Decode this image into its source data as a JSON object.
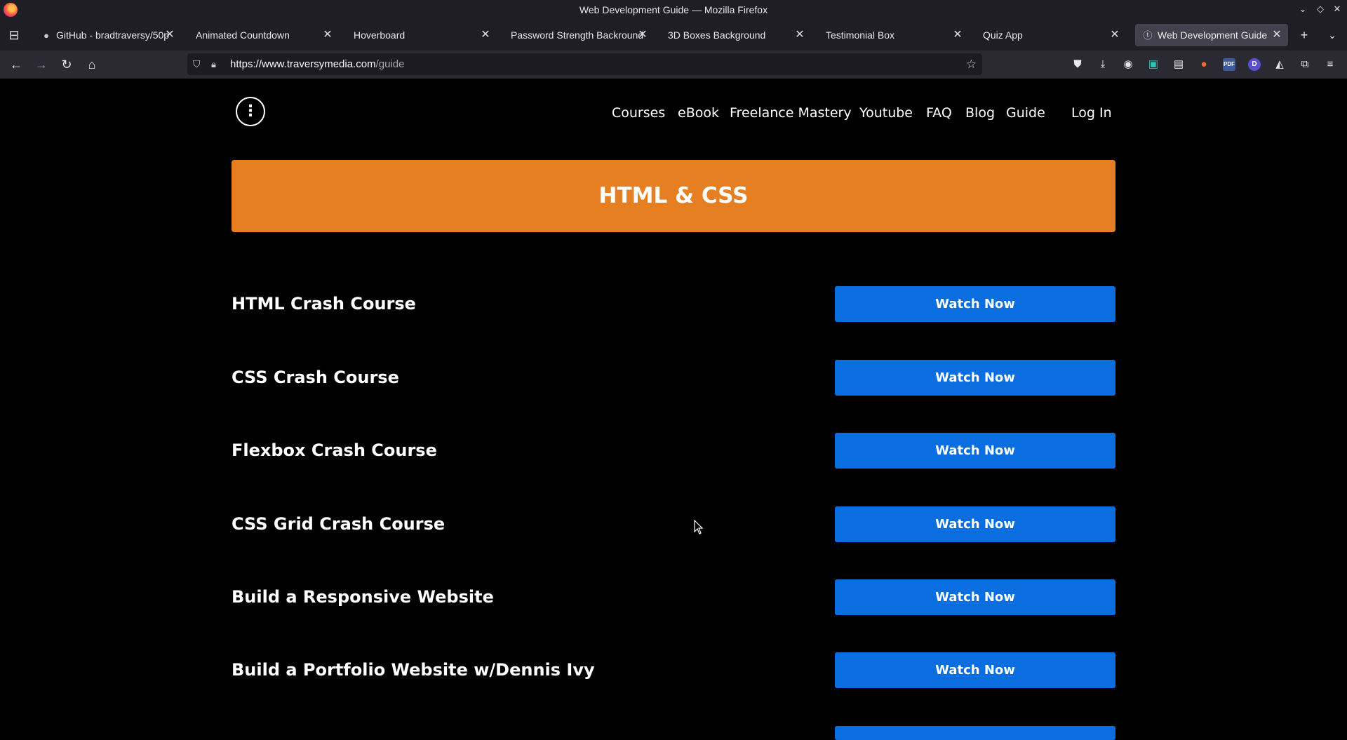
{
  "window": {
    "title": "Web Development Guide — Mozilla Firefox"
  },
  "tabs": [
    {
      "label": "GitHub - bradtraversy/50p",
      "icon": "github-icon",
      "active": false
    },
    {
      "label": "Animated Countdown",
      "icon": "",
      "active": false
    },
    {
      "label": "Hoverboard",
      "icon": "",
      "active": false
    },
    {
      "label": "Password Strength Backround",
      "icon": "",
      "active": false
    },
    {
      "label": "3D Boxes Background",
      "icon": "",
      "active": false
    },
    {
      "label": "Testimonial Box",
      "icon": "",
      "active": false
    },
    {
      "label": "Quiz App",
      "icon": "",
      "active": false
    },
    {
      "label": "Web Development Guide",
      "icon": "traversy-favicon-icon",
      "active": true
    }
  ],
  "urlbar": {
    "host": "https://www.traversymedia.com",
    "path": "/guide"
  },
  "site": {
    "logo_text": "⋮",
    "nav": [
      "Courses",
      "eBook",
      "Freelance Mastery",
      "Youtube",
      "FAQ",
      "Blog",
      "Guide"
    ],
    "login": "Log In"
  },
  "section": {
    "title": "HTML & CSS"
  },
  "courses": [
    {
      "title": "HTML Crash Course",
      "button": "Watch Now"
    },
    {
      "title": "CSS Crash Course",
      "button": "Watch Now"
    },
    {
      "title": "Flexbox Crash Course",
      "button": "Watch Now"
    },
    {
      "title": "CSS Grid Crash Course",
      "button": "Watch Now"
    },
    {
      "title": "Build a Responsive Website",
      "button": "Watch Now"
    },
    {
      "title": "Build a Portfolio Website w/Dennis Ivy",
      "button": "Watch Now"
    }
  ],
  "colors": {
    "banner": "#e67e22",
    "button": "#0a6ee0",
    "page_bg": "#000000"
  }
}
